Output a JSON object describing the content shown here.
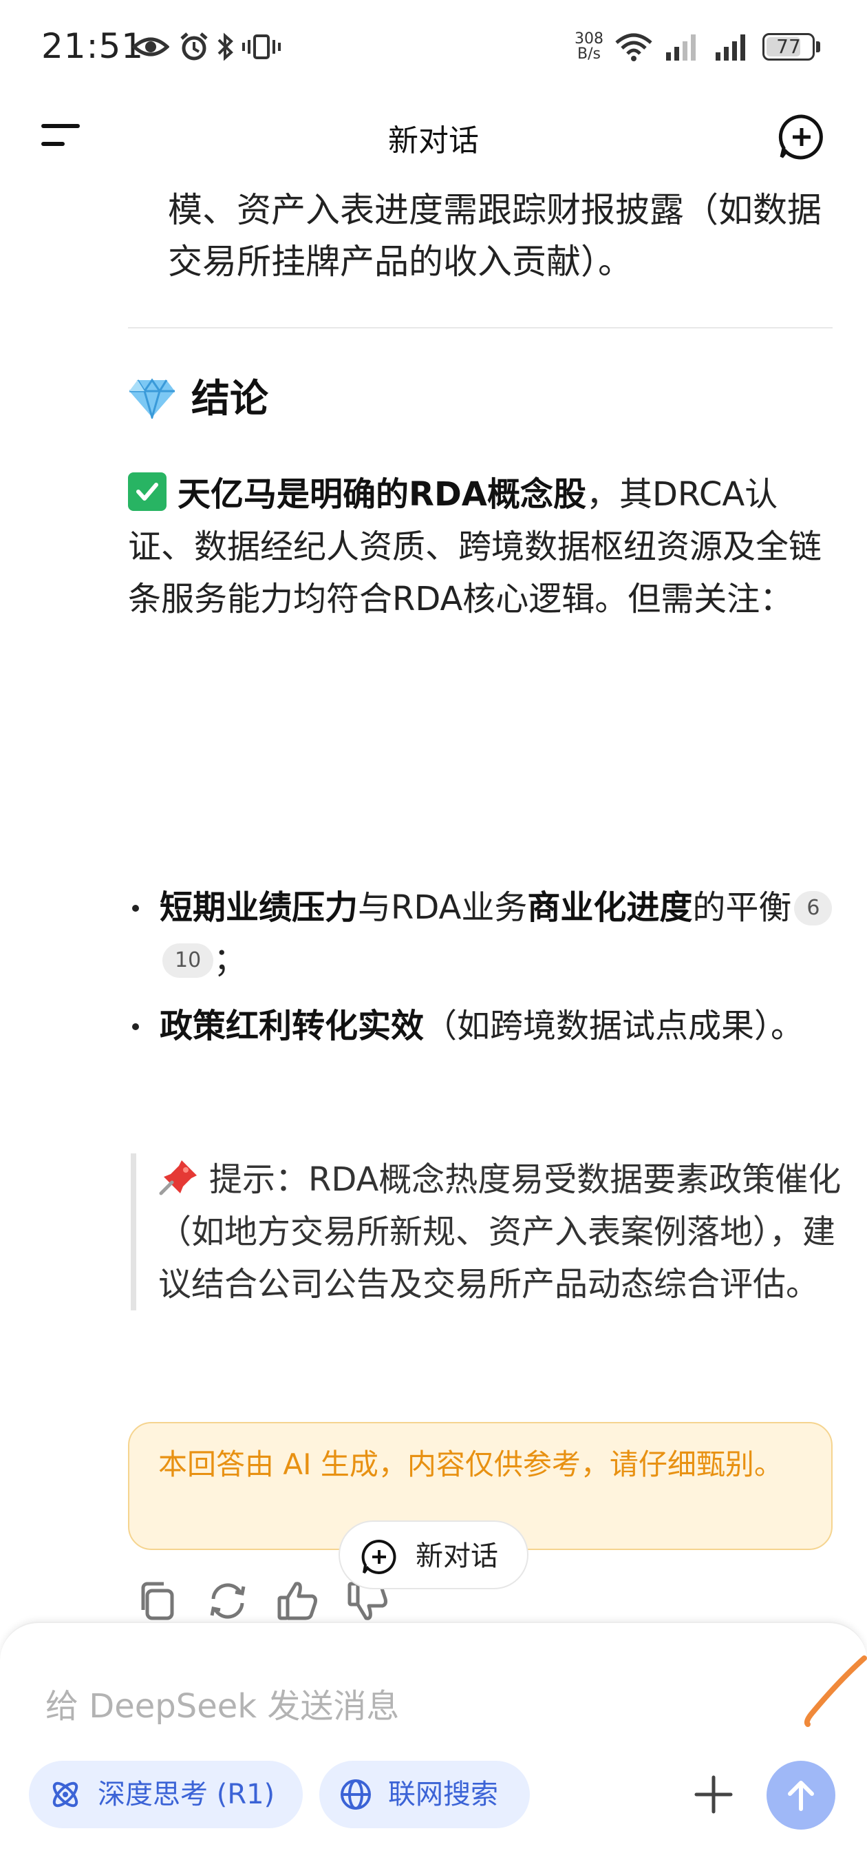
{
  "status_bar": {
    "time": "21:51",
    "net_speed_value": "308",
    "net_speed_unit": "B/s",
    "battery": "77",
    "battery_level": 0.77
  },
  "header": {
    "title": "新对话"
  },
  "conversation": {
    "truncated_paragraph": "模、资产入表进度需跟踪财报披露（如数据交易所挂牌产品的收入贡献）。",
    "conclusion": {
      "heading": "结论",
      "bold_lead": "天亿马是明确的RDA概念股",
      "body": "，其DRCA认证、数据经纪人资质、跨境数据枢纽资源及全链条服务能力均符合RDA核心逻辑。但需关注："
    },
    "bullets": [
      {
        "bold1": "短期业绩压力",
        "text1": "与RDA业务",
        "bold2": "商业化进度",
        "text2": "的平衡",
        "citations": [
          "6",
          "10"
        ],
        "end": "；"
      },
      {
        "bold1": "政策红利转化实效",
        "text1": "（如跨境数据试点成果）。"
      }
    ],
    "tip": "提示：RDA概念热度易受数据要素政策催化（如地方交易所新规、资产入表案例落地），建议结合公司公告及交易所产品动态综合评估。",
    "disclaimer": "本回答由 AI 生成，内容仅供参考，请仔细甄别。"
  },
  "actions": {
    "icons": [
      "copy-icon",
      "regenerate-icon",
      "thumbs-up-icon",
      "thumbs-down-icon"
    ]
  },
  "new_chat_button": {
    "label": "新对话"
  },
  "composer": {
    "placeholder": "给 DeepSeek 发送消息",
    "deep_think_label": "深度思考 (R1)",
    "web_search_label": "联网搜索"
  },
  "colors": {
    "accent_blue": "#3b63d6",
    "chip_bg": "#e8efff",
    "send_button": "#9fb8f7",
    "disclaimer_text": "#e89112",
    "disclaimer_bg": "#fff4dd"
  }
}
